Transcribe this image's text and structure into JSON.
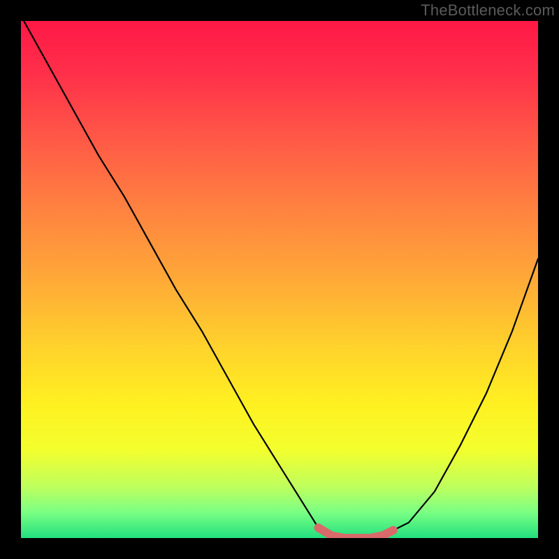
{
  "watermark": "TheBottleneck.com",
  "chart_data": {
    "type": "line",
    "title": "",
    "xlabel": "",
    "ylabel": "",
    "xlim": [
      0,
      1
    ],
    "ylim": [
      0,
      1
    ],
    "x": [
      0.0,
      0.05,
      0.1,
      0.15,
      0.2,
      0.25,
      0.3,
      0.35,
      0.4,
      0.45,
      0.5,
      0.55,
      0.575,
      0.6,
      0.625,
      0.65,
      0.675,
      0.7,
      0.75,
      0.8,
      0.85,
      0.9,
      0.95,
      1.0
    ],
    "values": [
      1.01,
      0.92,
      0.83,
      0.74,
      0.66,
      0.57,
      0.48,
      0.4,
      0.31,
      0.22,
      0.14,
      0.06,
      0.02,
      0.005,
      0.0,
      0.0,
      0.0,
      0.005,
      0.03,
      0.09,
      0.18,
      0.28,
      0.4,
      0.54
    ],
    "highlight": {
      "color": "#d86a6a",
      "x": [
        0.575,
        0.6,
        0.625,
        0.65,
        0.675,
        0.7,
        0.72
      ],
      "values": [
        0.02,
        0.005,
        0.0,
        0.0,
        0.0,
        0.005,
        0.015
      ]
    },
    "gradient_stops": [
      {
        "pos": 0.0,
        "color": "#ff1846"
      },
      {
        "pos": 0.5,
        "color": "#ffa938"
      },
      {
        "pos": 0.78,
        "color": "#fff021"
      },
      {
        "pos": 1.0,
        "color": "#22e07e"
      }
    ]
  }
}
